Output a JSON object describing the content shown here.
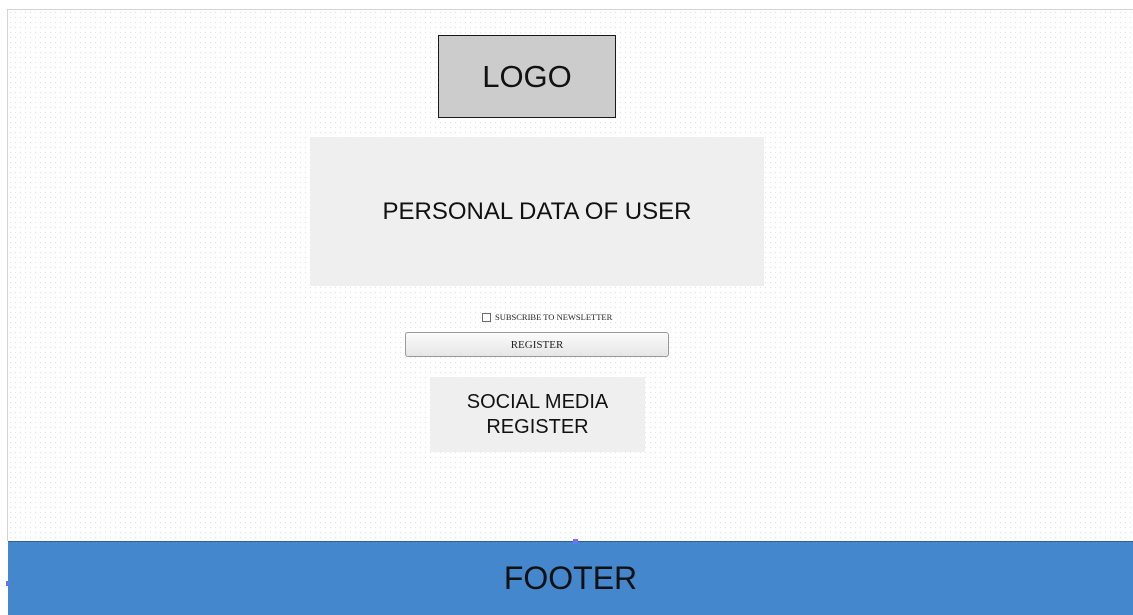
{
  "logo": {
    "label": "LOGO"
  },
  "personal_data": {
    "label": "PERSONAL DATA OF USER"
  },
  "newsletter": {
    "label": "SUBSCRIBE TO NEWSLETTER",
    "checked": false
  },
  "register_button": {
    "label": "REGISTER"
  },
  "social_register": {
    "line1": "SOCIAL MEDIA",
    "line2": "REGISTER"
  },
  "footer": {
    "label": "FOOTER"
  },
  "colors": {
    "footer_background": "#4487cc",
    "logo_background": "#cccccc",
    "panel_background": "#efefef",
    "selection_handle": "#6a73f0"
  }
}
